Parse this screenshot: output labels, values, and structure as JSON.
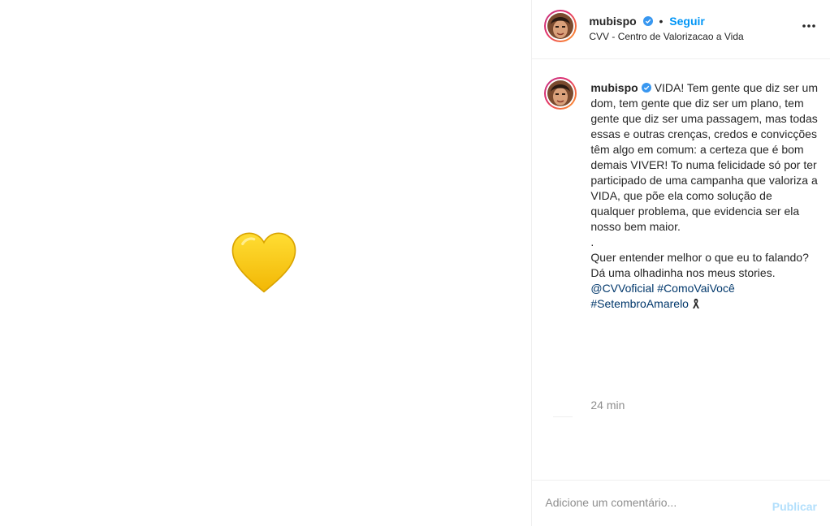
{
  "post": {
    "username": "mubispo",
    "verified_icon": "verified-badge-icon",
    "follow_label": "Seguir",
    "location": "CVV - Centro de Valorizacao a Vida",
    "more_icon": "more-options-icon",
    "media_emoji": "yellow-heart-icon",
    "accent_color": "#0095f6",
    "heart_color": "#FFCC1A"
  },
  "caption": {
    "username": "mubispo",
    "text_main": "VIDA! Tem gente que diz ser um dom, tem gente que diz ser um plano, tem gente que diz ser uma passagem, mas todas essas e outras crenças, credos e convicções têm algo em comum: a certeza que é bom demais VIVER! To numa felicidade só por ter participado de uma campanha que valoriza a VIDA, que põe ela como solução de qualquer problema, que evidencia ser ela nosso bem maior.\n.\nQuer entender melhor o que eu to falando? Dá uma olhadinha nos meus stories. ",
    "mention": "@CVVoficial",
    "hashtag1": "#ComoVaiVocê",
    "hashtag2": "#SetembroAmarelo",
    "ribbon_icon": "awareness-ribbon-icon",
    "time": "24 min"
  },
  "comment": {
    "placeholder": "Adicione um comentário...",
    "publish_label": "Publicar"
  }
}
